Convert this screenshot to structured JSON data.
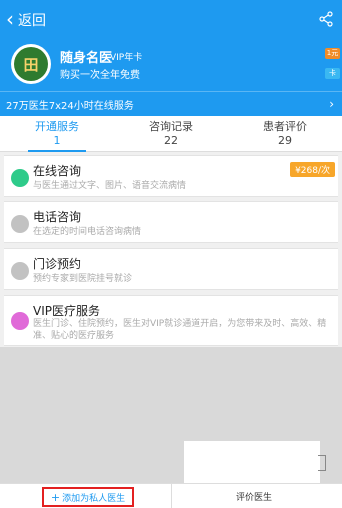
{
  "topbar": {
    "back_label": "返回"
  },
  "doctor_card": {
    "title": "随身名医",
    "tag": "VIP年卡",
    "subtitle": "购买一次全年免费",
    "badge_top": "1元",
    "badge_bottom": "卡"
  },
  "banner": {
    "text": "27万医生7x24小时在线服务"
  },
  "tabs": [
    {
      "label": "开通服务",
      "count": "1",
      "active": true
    },
    {
      "label": "咨询记录",
      "count": "22",
      "active": false
    },
    {
      "label": "患者评价",
      "count": "29",
      "active": false
    }
  ],
  "services": [
    {
      "title": "在线咨询",
      "desc": "与医生通过文字、图片、语音交流病情",
      "price": "¥268/次",
      "icon_color": "#2ecb8a"
    },
    {
      "title": "电话咨询",
      "desc": "在选定的时间电话咨询病情",
      "icon_color": "#c2c2c2"
    },
    {
      "title": "门诊预约",
      "desc": "预约专家到医院挂号就诊",
      "icon_color": "#c2c2c2"
    },
    {
      "title": "VIP医疗服务",
      "desc": "医生门诊、住院预约，医生对VIP就诊通道开启，为您带来及时、高效、精准、贴心的医疗服务",
      "icon_color": "#e06ad8"
    }
  ],
  "bottom": {
    "add_private": "添加为私人医生",
    "rate": "评价医生"
  },
  "colors": {
    "primary": "#1e9af0",
    "price_bg": "#f7a62a",
    "highlight": "#e32020"
  }
}
